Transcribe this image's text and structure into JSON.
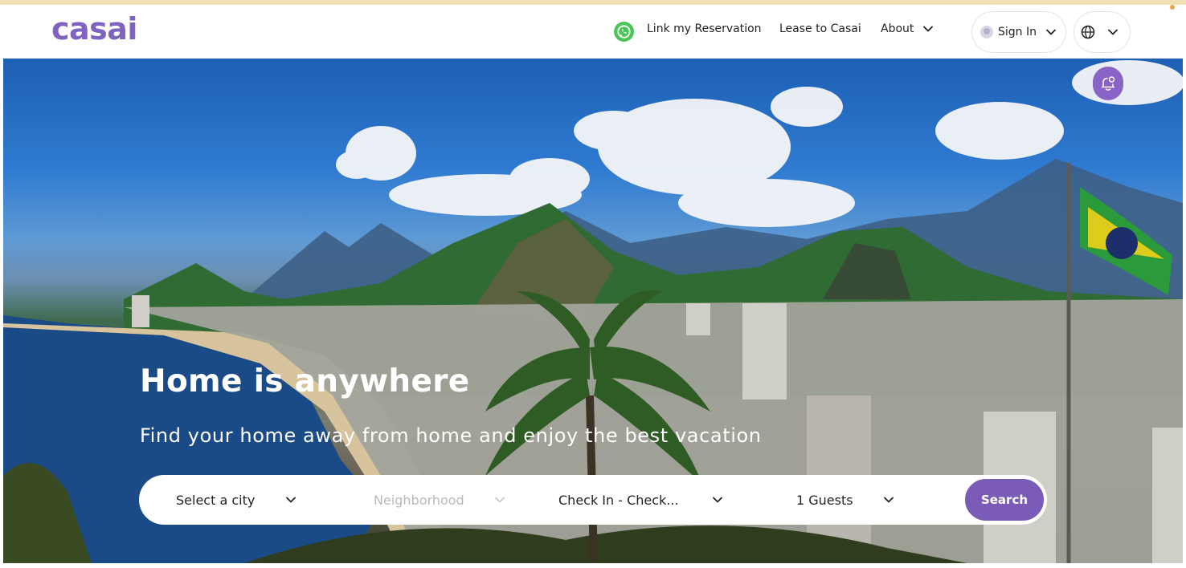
{
  "brand": {
    "logo_text": "casai",
    "accent": "#7b5bb8",
    "logo_color": "#7e63c0"
  },
  "nav": {
    "whatsapp_icon": "whatsapp-icon",
    "link_reservation": "Link my Reservation",
    "lease": "Lease to Casai",
    "about": "About",
    "sign_in": "Sign In",
    "language_icon": "globe-icon"
  },
  "hero": {
    "title": "Home is anywhere",
    "subtitle": "Find your home away from home and enjoy the best vacation",
    "notification_icon": "bell-icon"
  },
  "search": {
    "city": "Select a city",
    "neighborhood": "Neighborhood",
    "dates": "Check In - Check...",
    "guests": "1 Guests",
    "button": "Search"
  }
}
